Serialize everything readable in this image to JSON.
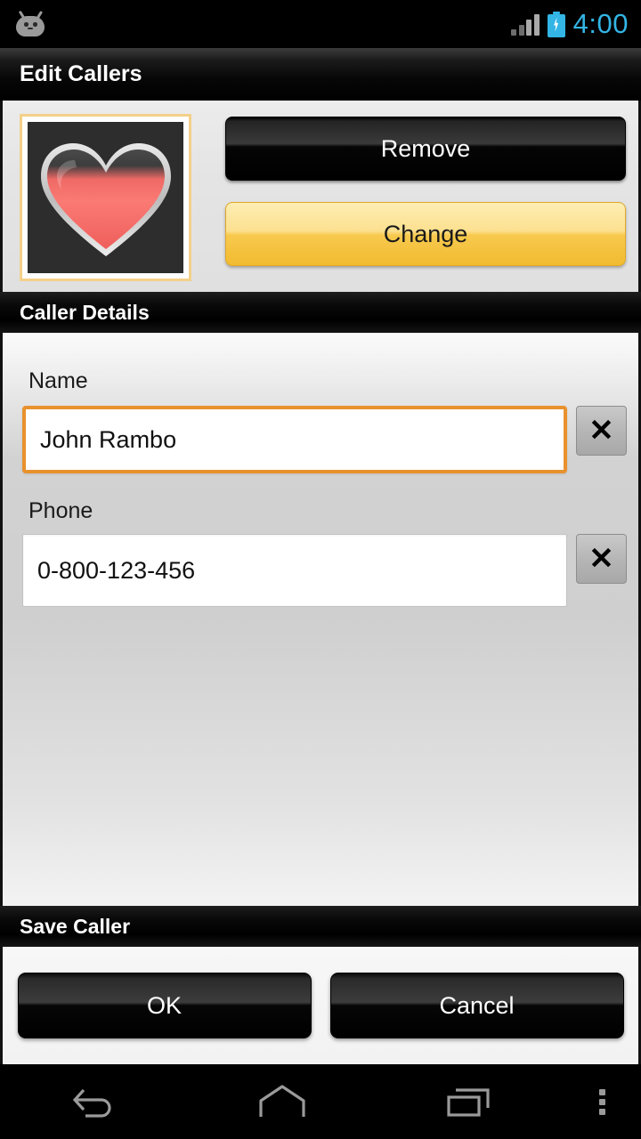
{
  "statusbar": {
    "mascot_icon": "android-mascot-icon",
    "signal_icon": "signal-bars-icon",
    "battery_icon": "battery-charging-icon",
    "time": "4:00",
    "accent_color": "#33b5e5"
  },
  "titlebar": {
    "title": "Edit Callers"
  },
  "avatar_panel": {
    "avatar_icon": "heart-avatar-icon",
    "remove_label": "Remove",
    "change_label": "Change",
    "remove_color": "#000000",
    "change_color": "#f7c94e",
    "avatar_border_color": "#f3d08a"
  },
  "details_section": {
    "header": "Caller Details",
    "fields": [
      {
        "label": "Name",
        "value": "John Rambo",
        "placeholder": "Name",
        "focused": true,
        "clear_icon": "close-icon",
        "focus_color": "#e8912d"
      },
      {
        "label": "Phone",
        "value": "0-800-123-456",
        "placeholder": "Phone",
        "focused": false,
        "clear_icon": "close-icon"
      }
    ]
  },
  "save_section": {
    "header": "Save Caller",
    "ok_label": "OK",
    "cancel_label": "Cancel"
  },
  "navbar": {
    "back_icon": "back-arrow-icon",
    "home_icon": "home-icon",
    "recents_icon": "recent-apps-icon",
    "menu_icon": "overflow-menu-icon"
  }
}
